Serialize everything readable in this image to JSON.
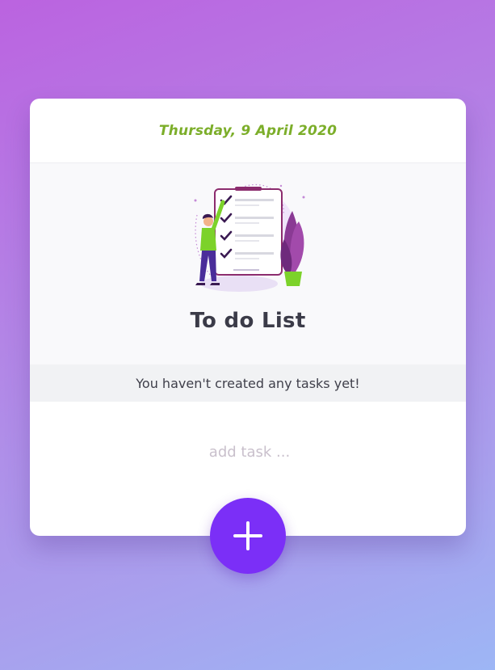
{
  "header": {
    "date": "Thursday, 9 April 2020"
  },
  "hero": {
    "title": "To do List",
    "illustration_icon": "checklist-illustration-icon"
  },
  "status": {
    "empty_message": "You haven't created any tasks yet!"
  },
  "task_input": {
    "placeholder": "add task ...",
    "value": ""
  },
  "add_button": {
    "icon": "plus-icon",
    "color": "#7b2ff7"
  },
  "colors": {
    "accent_green": "#7cae2a",
    "accent_purple": "#7b2ff7",
    "title_text": "#3b3b48"
  }
}
